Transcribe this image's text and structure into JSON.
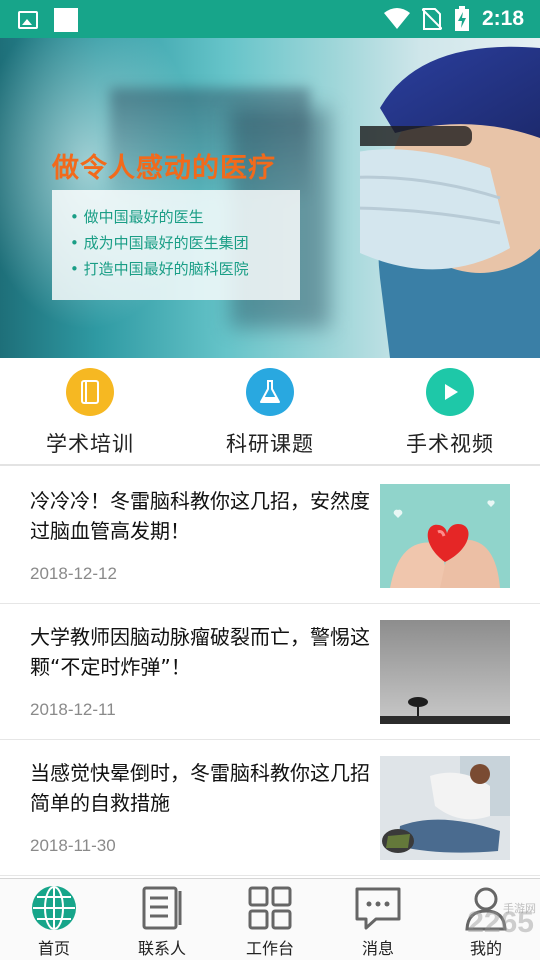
{
  "status_bar": {
    "time": "2:18"
  },
  "banner": {
    "title": "做令人感动的医疗",
    "bullets": [
      "做中国最好的医生",
      "成为中国最好的医生集团",
      "打造中国最好的脑科医院"
    ]
  },
  "quick_menu": [
    {
      "label": "学术培训",
      "icon": "book-icon",
      "color": "#f6b822"
    },
    {
      "label": "科研课题",
      "icon": "flask-icon",
      "color": "#29a8e0"
    },
    {
      "label": "手术视频",
      "icon": "play-icon",
      "color": "#1ec8a8"
    }
  ],
  "news": [
    {
      "title": "冷冷冷！冬雷脑科教你这几招，安然度过脑血管高发期！",
      "date": "2018-12-12",
      "thumb": "heart-in-hands-image"
    },
    {
      "title": "大学教师因脑动脉瘤破裂而亡，警惕这颗“不定时炸弹”！",
      "date": "2018-12-11",
      "thumb": "lone-tree-image"
    },
    {
      "title": "当感觉快晕倒时，冬雷脑科教你这几招简单的自救措施",
      "date": "2018-11-30",
      "thumb": "first-aid-image"
    }
  ],
  "bottom_nav": [
    {
      "label": "首页",
      "icon": "globe-icon",
      "active": true
    },
    {
      "label": "联系人",
      "icon": "contacts-icon",
      "active": false
    },
    {
      "label": "工作台",
      "icon": "grid-icon",
      "active": false
    },
    {
      "label": "消息",
      "icon": "chat-icon",
      "active": false
    },
    {
      "label": "我的",
      "icon": "person-icon",
      "active": false
    }
  ],
  "watermark": {
    "logo": "2265",
    "sub": "手游网"
  },
  "colors": {
    "primary": "#17a58a",
    "accent_orange": "#f26a1b"
  }
}
